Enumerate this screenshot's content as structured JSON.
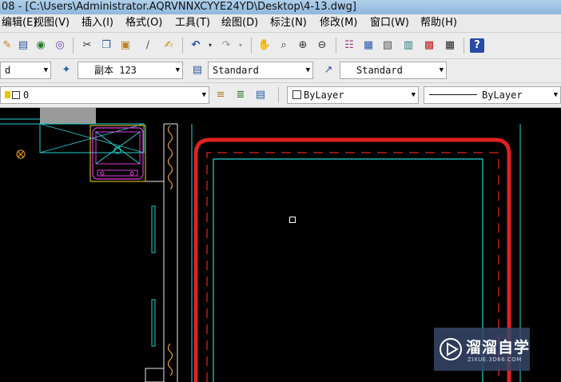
{
  "window": {
    "title": "08 - [C:\\Users\\Administrator.AQRVNNXCYYE24YD\\Desktop\\4-13.dwg]"
  },
  "menu": {
    "items": [
      "编辑(E)",
      "视图(V)",
      "插入(I)",
      "格式(O)",
      "工具(T)",
      "绘图(D)",
      "标注(N)",
      "修改(M)",
      "窗口(W)",
      "帮助(H)"
    ]
  },
  "toolbar": {
    "icons": [
      "open-icon",
      "print-preview-icon",
      "publish-icon",
      "plot-icon",
      "cut-icon",
      "copy-icon",
      "paste-icon",
      "brush-icon",
      "match-properties-icon",
      "undo-icon",
      "redo-icon",
      "pan-icon",
      "zoom-realtime-icon",
      "zoom-window-icon",
      "zoom-previous-icon",
      "properties-icon",
      "design-center-icon",
      "tool-palettes-icon",
      "sheet-set-icon",
      "markup-icon",
      "calculator-icon",
      "help-icon"
    ]
  },
  "styles": {
    "text_style_value": "d",
    "dim_style_value": "副本 123",
    "table_style_value": "Standard",
    "multileader_style_value": "Standard"
  },
  "layers": {
    "current_layer": "0",
    "color_value": "ByLayer",
    "linetype_value": "ByLayer"
  },
  "watermark": {
    "brand": "溜溜自学",
    "url": "ZIXUE.3D66.COM"
  },
  "colors": {
    "wall_red": "#e02020",
    "cyan_lines": "#22d3d3",
    "magenta_block": "#e040e0",
    "canvas_bg": "#000000",
    "orange_marker": "#f0a020"
  }
}
